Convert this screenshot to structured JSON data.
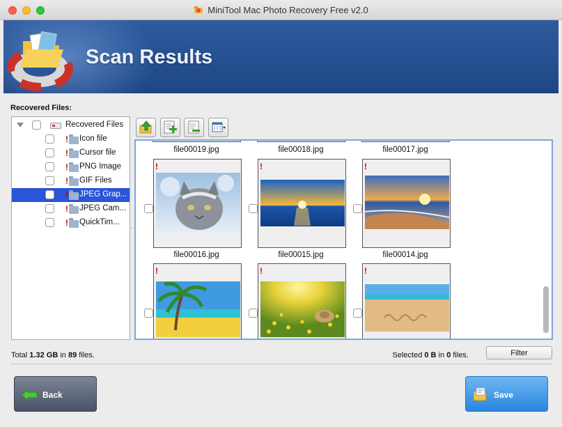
{
  "window": {
    "title": "MiniTool Mac Photo Recovery Free v2.0"
  },
  "banner": {
    "title": "Scan Results"
  },
  "tree": {
    "label": "Recovered Files:",
    "root": "Recovered Files",
    "items": [
      {
        "label": "Icon file",
        "selected": false
      },
      {
        "label": "Cursor file",
        "selected": false
      },
      {
        "label": "PNG Image",
        "selected": false
      },
      {
        "label": "GIF Files",
        "selected": false
      },
      {
        "label": "JPEG Grap...",
        "selected": true
      },
      {
        "label": "JPEG Cam...",
        "selected": false
      },
      {
        "label": "QuickTim...",
        "selected": false
      }
    ]
  },
  "toolbar": {
    "buttons": [
      "up-folder-icon",
      "add-check-icon",
      "remove-check-icon",
      "view-mode-icon"
    ]
  },
  "grid": {
    "top_partial_names": [
      "file00019.jpg",
      "file00018.jpg",
      "file00017.jpg"
    ],
    "row1_names": [
      "file00016.jpg",
      "file00015.jpg",
      "file00014.jpg"
    ],
    "row1_images": [
      "snow-cat",
      "ocean-sunset",
      "beach-sunset"
    ],
    "row2_images": [
      "palm-beach",
      "sunny-field",
      "sand-summer"
    ]
  },
  "status": {
    "total_prefix": "Total ",
    "total_size": "1.32 GB",
    "total_mid": " in ",
    "total_count": "89",
    "total_suffix": " files.",
    "selected_prefix": "Selected ",
    "selected_size": "0 B",
    "selected_mid": " in ",
    "selected_count": "0",
    "selected_suffix": " files."
  },
  "buttons": {
    "filter": "Filter",
    "back": "Back",
    "save": "Save"
  },
  "colors": {
    "banner": "#2a5394",
    "selection": "#2a55d8",
    "panel_border": "#7aa6db",
    "save": "#2a86de",
    "back": "#5a6374"
  }
}
